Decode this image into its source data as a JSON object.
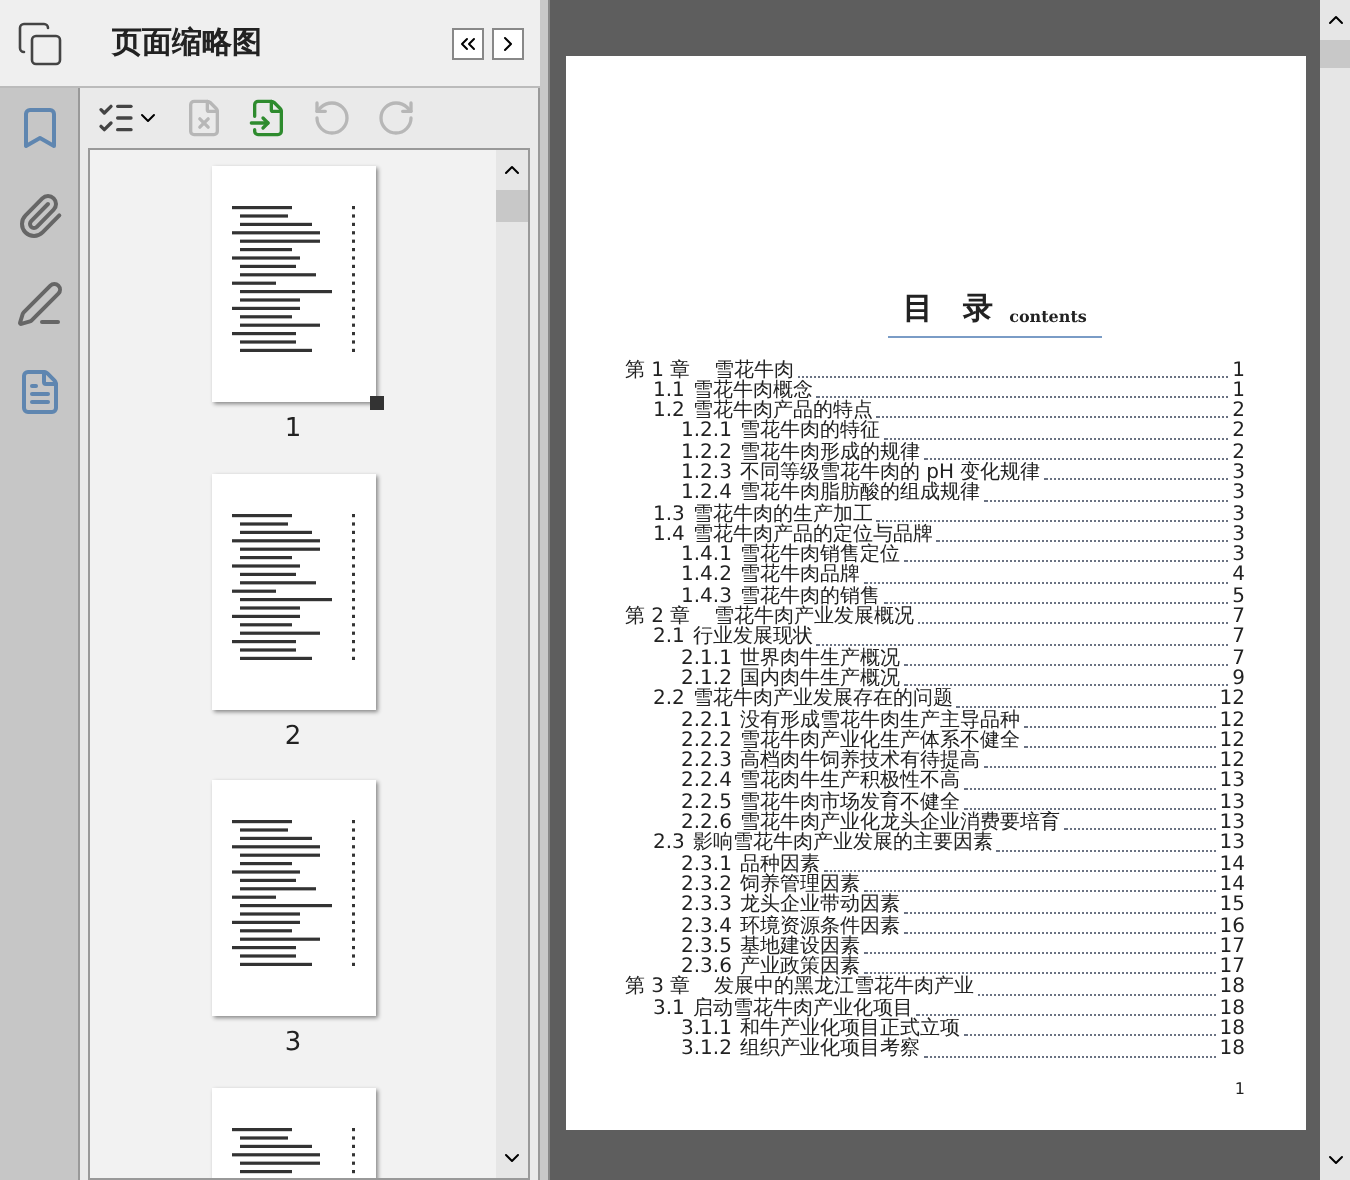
{
  "panel": {
    "title": "页面缩略图"
  },
  "toolbar": [
    {
      "kind": "options",
      "disabled": false
    },
    {
      "kind": "delete",
      "disabled": true
    },
    {
      "kind": "insert",
      "disabled": false
    },
    {
      "kind": "undo",
      "disabled": true
    },
    {
      "kind": "redo",
      "disabled": true
    }
  ],
  "thumbnails": [
    {
      "label": "1",
      "selected": true
    },
    {
      "label": "2",
      "selected": false
    },
    {
      "label": "3",
      "selected": false
    },
    {
      "selected": false
    }
  ],
  "document": {
    "title": "目　录",
    "subtitle": "contents",
    "page_number": "1",
    "toc": [
      {
        "number": "第 1 章",
        "title": "雪花牛肉",
        "page": "1",
        "children": [
          {
            "number": "1.1",
            "title": "雪花牛肉概念",
            "page": "1"
          },
          {
            "number": "1.2",
            "title": "雪花牛肉产品的特点",
            "page": "2",
            "children": [
              {
                "number": "1.2.1",
                "title": "雪花牛肉的特征",
                "page": "2"
              },
              {
                "number": "1.2.2",
                "title": "雪花牛肉形成的规律",
                "page": "2"
              },
              {
                "number": "1.2.3",
                "title": "不同等级雪花牛肉的 pH 变化规律",
                "page": "3"
              },
              {
                "number": "1.2.4",
                "title": "雪花牛肉脂肪酸的组成规律",
                "page": "3"
              }
            ]
          },
          {
            "number": "1.3",
            "title": "雪花牛肉的生产加工",
            "page": "3"
          },
          {
            "number": "1.4",
            "title": "雪花牛肉产品的定位与品牌",
            "page": "3",
            "children": [
              {
                "number": "1.4.1",
                "title": "雪花牛肉销售定位",
                "page": "3"
              },
              {
                "number": "1.4.2",
                "title": "雪花牛肉品牌",
                "page": "4"
              },
              {
                "number": "1.4.3",
                "title": "雪花牛肉的销售",
                "page": "5"
              }
            ]
          }
        ]
      },
      {
        "number": "第 2 章",
        "title": "雪花牛肉产业发展概况",
        "page": "7",
        "children": [
          {
            "number": "2.1",
            "title": "行业发展现状",
            "page": "7",
            "children": [
              {
                "number": "2.1.1",
                "title": "世界肉牛生产概况",
                "page": "7"
              },
              {
                "number": "2.1.2",
                "title": "国内肉牛生产概况",
                "page": "9"
              }
            ]
          },
          {
            "number": "2.2",
            "title": "雪花牛肉产业发展存在的问题",
            "page": "12",
            "children": [
              {
                "number": "2.2.1",
                "title": "没有形成雪花牛肉生产主导品种",
                "page": "12"
              },
              {
                "number": "2.2.2",
                "title": "雪花牛肉产业化生产体系不健全",
                "page": "12"
              },
              {
                "number": "2.2.3",
                "title": "高档肉牛饲养技术有待提高",
                "page": "12"
              },
              {
                "number": "2.2.4",
                "title": "雪花肉牛生产积极性不高",
                "page": "13"
              },
              {
                "number": "2.2.5",
                "title": "雪花牛肉市场发育不健全",
                "page": "13"
              },
              {
                "number": "2.2.6",
                "title": "雪花牛肉产业化龙头企业消费要培育",
                "page": "13"
              }
            ]
          },
          {
            "number": "2.3",
            "title": "影响雪花牛肉产业发展的主要因素",
            "page": "13",
            "children": [
              {
                "number": "2.3.1",
                "title": "品种因素",
                "page": "14"
              },
              {
                "number": "2.3.2",
                "title": "饲养管理因素",
                "page": "14"
              },
              {
                "number": "2.3.3",
                "title": "龙头企业带动因素",
                "page": "15"
              },
              {
                "number": "2.3.4",
                "title": "环境资源条件因素",
                "page": "16"
              },
              {
                "number": "2.3.5",
                "title": "基地建设因素",
                "page": "17"
              },
              {
                "number": "2.3.6",
                "title": "产业政策因素",
                "page": "17"
              }
            ]
          }
        ]
      },
      {
        "number": "第 3 章",
        "title": "发展中的黑龙江雪花牛肉产业",
        "page": "18",
        "children": [
          {
            "number": "3.1",
            "title": "启动雪花牛肉产业化项目",
            "page": "18",
            "children": [
              {
                "number": "3.1.1",
                "title": "和牛产业化项目正式立项",
                "page": "18"
              },
              {
                "number": "3.1.2",
                "title": "组织产业化项目考察",
                "page": "18"
              }
            ]
          }
        ]
      }
    ]
  }
}
